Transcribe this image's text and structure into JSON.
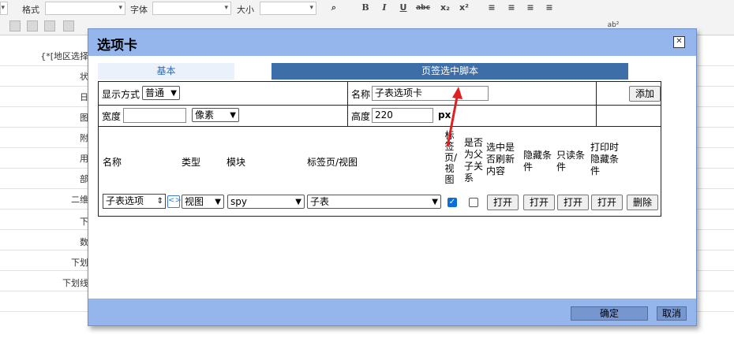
{
  "toolbar": {
    "format_label": "格式",
    "font_label": "字体",
    "size_label": "大小",
    "bold": "B",
    "italic": "I",
    "underline": "U",
    "strike": "abc",
    "subscript": "x₂",
    "superscript": "x²",
    "ab_label": "ab²"
  },
  "background_labels": [
    "{*[地区选择",
    "状",
    "日",
    "图",
    "附",
    "用",
    "部",
    "二维",
    "下",
    "数",
    "下划",
    "下划线"
  ],
  "dialog": {
    "title": "选项卡",
    "tabs": {
      "basic": "基本",
      "script": "页签选中脚本"
    },
    "row1": {
      "display_label": "显示方式",
      "display_value": "普通",
      "name_label": "名称",
      "name_value": "子表选项卡",
      "add_button": "添加"
    },
    "row2": {
      "width_label": "宽度",
      "width_value": "",
      "unit_value": "像素",
      "height_label": "高度",
      "height_value": "220",
      "unit_px": "px"
    },
    "headers": {
      "name": "名称",
      "type": "类型",
      "module": "模块",
      "tab_view": "标签页/视图",
      "is_tab_view": "标签页/视图",
      "is_parent_child": "是否为父子关系",
      "refresh_on_select": "选中是否刷新内容",
      "hide_condition": "隐藏条件",
      "readonly_condition": "只读条件",
      "print_hide_condition": "打印时隐藏条件"
    },
    "row": {
      "name_value": "子表选项",
      "type_value": "视图",
      "module_value": "spy",
      "view_value": "子表",
      "is_tab_view_checked": true,
      "is_parent_child_checked": false,
      "open1": "打开",
      "open2": "打开",
      "open3": "打开",
      "open4": "打开",
      "delete": "删除"
    },
    "footer": {
      "ok": "确定",
      "cancel": "取消"
    }
  }
}
